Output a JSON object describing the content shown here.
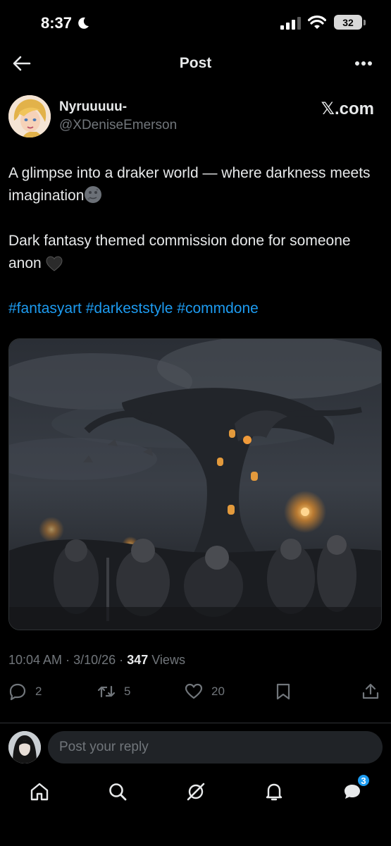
{
  "status_bar": {
    "time": "8:37",
    "battery": "32"
  },
  "nav": {
    "title": "Post"
  },
  "author": {
    "name": "Nyruuuuu-",
    "handle": "@XDeniseEmerson",
    "source": "𝕏.com"
  },
  "post": {
    "line1": "A glimpse into a draker world — where darkness meets imagination",
    "line2": "Dark fantasy themed commission done for someone anon",
    "hashtags": "#fantasyart #darkeststyle #commdone"
  },
  "meta": {
    "time": "10:04 AM",
    "date": "3/10/26",
    "views_count": "347",
    "views_label": "Views",
    "sep": "·"
  },
  "actions": {
    "replies": "2",
    "reposts": "5",
    "likes": "20"
  },
  "reply": {
    "placeholder": "Post your reply"
  },
  "tabs": {
    "messages_badge": "3"
  },
  "colors": {
    "accent": "#1d9bf0",
    "muted": "#71767b",
    "background": "#000000"
  }
}
